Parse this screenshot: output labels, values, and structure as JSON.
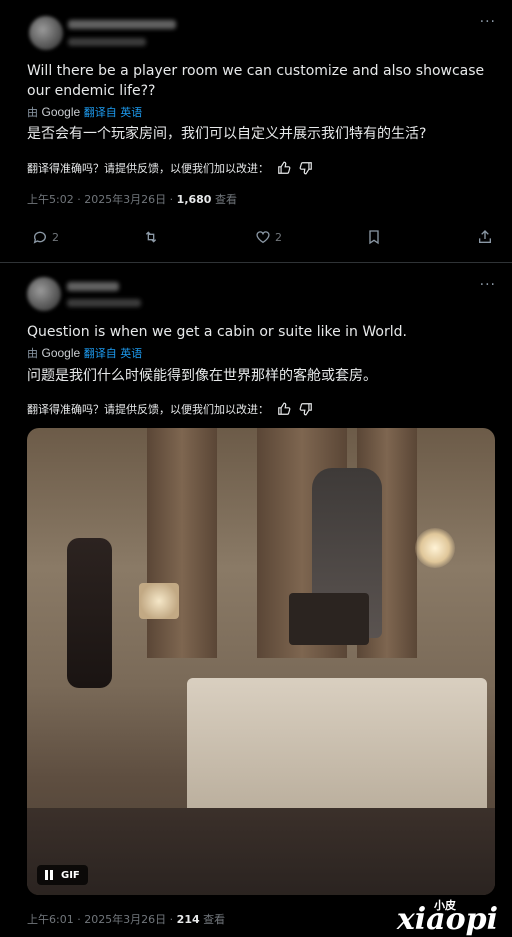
{
  "tweet1": {
    "more_label": "···",
    "text_en": "Will there be a player room we can customize and also showcase our endemic life??",
    "translated_prefix": "由",
    "translated_google": "Google",
    "translated_link": "翻译自 英语",
    "text_zh": "是否会有一个玩家房间，我们可以自定义并展示我们特有的生活?",
    "feedback": "翻译得准确吗？请提供反馈，以便我们加以改进：",
    "meta_time": "上午5:02 · 2025年3月26日 · ",
    "meta_views": "1,680",
    "meta_views_label": " 查看",
    "replies": "2",
    "likes": "2"
  },
  "tweet2": {
    "more_label": "···",
    "text_en": "Question is when we get a cabin or suite like in World.",
    "translated_prefix": "由",
    "translated_google": "Google",
    "translated_link": "翻译自 英语",
    "text_zh": "问题是我们什么时候能得到像在世界那样的客舱或套房。",
    "feedback": "翻译得准确吗？请提供反馈，以便我们加以改进：",
    "gif_label": "GIF",
    "meta_time": "上午6:01 · 2025年3月26日 · ",
    "meta_views": "214",
    "meta_views_label": " 查看"
  },
  "watermark": {
    "main": "xiaopi",
    "small": "小皮"
  },
  "icons": [
    "more-icon",
    "thumbs-up-icon",
    "thumbs-down-icon",
    "reply-icon",
    "retweet-icon",
    "like-icon",
    "bookmark-icon",
    "share-icon",
    "pause-icon"
  ]
}
